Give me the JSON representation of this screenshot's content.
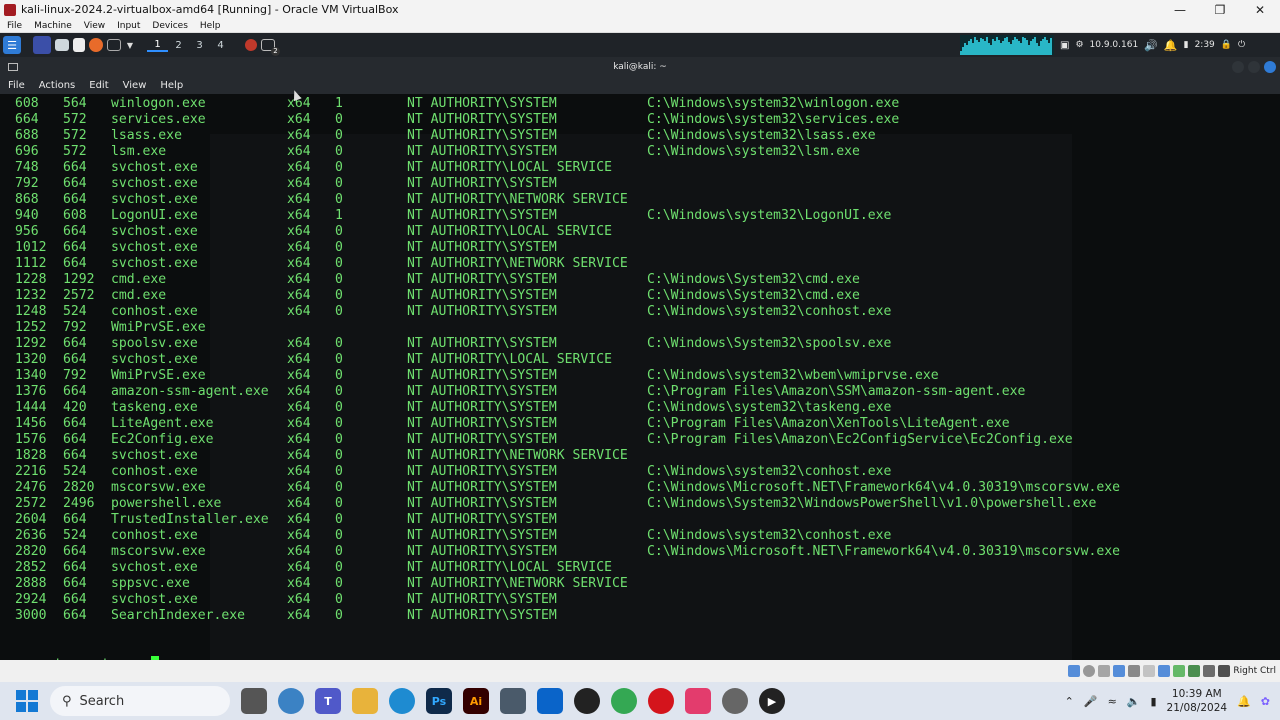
{
  "vbox": {
    "title": "kali-linux-2024.2-virtualbox-amd64 [Running] - Oracle VM VirtualBox",
    "menu": [
      "File",
      "Machine",
      "View",
      "Input",
      "Devices",
      "Help"
    ],
    "status_hint": "Right Ctrl"
  },
  "kali_panel": {
    "workspaces": [
      "1",
      "2",
      "3",
      "4"
    ],
    "active_workspace": "1",
    "terminal_badge": "2",
    "ip_address": "10.9.0.161",
    "time": "2:39"
  },
  "terminal": {
    "title": "kali@kali: ~",
    "menu": [
      "File",
      "Actions",
      "Edit",
      "View",
      "Help"
    ],
    "text_color": "#6fe06f",
    "processes": [
      {
        "pid": "608",
        "ppid": "564",
        "name": "winlogon.exe",
        "arch": "x64",
        "session": "1",
        "user": "NT AUTHORITY\\SYSTEM",
        "path": "C:\\Windows\\system32\\winlogon.exe"
      },
      {
        "pid": "664",
        "ppid": "572",
        "name": "services.exe",
        "arch": "x64",
        "session": "0",
        "user": "NT AUTHORITY\\SYSTEM",
        "path": "C:\\Windows\\system32\\services.exe"
      },
      {
        "pid": "688",
        "ppid": "572",
        "name": "lsass.exe",
        "arch": "x64",
        "session": "0",
        "user": "NT AUTHORITY\\SYSTEM",
        "path": "C:\\Windows\\system32\\lsass.exe"
      },
      {
        "pid": "696",
        "ppid": "572",
        "name": "lsm.exe",
        "arch": "x64",
        "session": "0",
        "user": "NT AUTHORITY\\SYSTEM",
        "path": "C:\\Windows\\system32\\lsm.exe"
      },
      {
        "pid": "748",
        "ppid": "664",
        "name": "svchost.exe",
        "arch": "x64",
        "session": "0",
        "user": "NT AUTHORITY\\LOCAL SERVICE",
        "path": ""
      },
      {
        "pid": "792",
        "ppid": "664",
        "name": "svchost.exe",
        "arch": "x64",
        "session": "0",
        "user": "NT AUTHORITY\\SYSTEM",
        "path": ""
      },
      {
        "pid": "868",
        "ppid": "664",
        "name": "svchost.exe",
        "arch": "x64",
        "session": "0",
        "user": "NT AUTHORITY\\NETWORK SERVICE",
        "path": ""
      },
      {
        "pid": "940",
        "ppid": "608",
        "name": "LogonUI.exe",
        "arch": "x64",
        "session": "1",
        "user": "NT AUTHORITY\\SYSTEM",
        "path": "C:\\Windows\\system32\\LogonUI.exe"
      },
      {
        "pid": "956",
        "ppid": "664",
        "name": "svchost.exe",
        "arch": "x64",
        "session": "0",
        "user": "NT AUTHORITY\\LOCAL SERVICE",
        "path": ""
      },
      {
        "pid": "1012",
        "ppid": "664",
        "name": "svchost.exe",
        "arch": "x64",
        "session": "0",
        "user": "NT AUTHORITY\\SYSTEM",
        "path": ""
      },
      {
        "pid": "1112",
        "ppid": "664",
        "name": "svchost.exe",
        "arch": "x64",
        "session": "0",
        "user": "NT AUTHORITY\\NETWORK SERVICE",
        "path": ""
      },
      {
        "pid": "1228",
        "ppid": "1292",
        "name": "cmd.exe",
        "arch": "x64",
        "session": "0",
        "user": "NT AUTHORITY\\SYSTEM",
        "path": "C:\\Windows\\System32\\cmd.exe"
      },
      {
        "pid": "1232",
        "ppid": "2572",
        "name": "cmd.exe",
        "arch": "x64",
        "session": "0",
        "user": "NT AUTHORITY\\SYSTEM",
        "path": "C:\\Windows\\System32\\cmd.exe"
      },
      {
        "pid": "1248",
        "ppid": "524",
        "name": "conhost.exe",
        "arch": "x64",
        "session": "0",
        "user": "NT AUTHORITY\\SYSTEM",
        "path": "C:\\Windows\\system32\\conhost.exe"
      },
      {
        "pid": "1252",
        "ppid": "792",
        "name": "WmiPrvSE.exe",
        "arch": "",
        "session": "",
        "user": "",
        "path": ""
      },
      {
        "pid": "1292",
        "ppid": "664",
        "name": "spoolsv.exe",
        "arch": "x64",
        "session": "0",
        "user": "NT AUTHORITY\\SYSTEM",
        "path": "C:\\Windows\\System32\\spoolsv.exe"
      },
      {
        "pid": "1320",
        "ppid": "664",
        "name": "svchost.exe",
        "arch": "x64",
        "session": "0",
        "user": "NT AUTHORITY\\LOCAL SERVICE",
        "path": ""
      },
      {
        "pid": "1340",
        "ppid": "792",
        "name": "WmiPrvSE.exe",
        "arch": "x64",
        "session": "0",
        "user": "NT AUTHORITY\\SYSTEM",
        "path": "C:\\Windows\\system32\\wbem\\wmiprvse.exe"
      },
      {
        "pid": "1376",
        "ppid": "664",
        "name": "amazon-ssm-agent.exe",
        "arch": "x64",
        "session": "0",
        "user": "NT AUTHORITY\\SYSTEM",
        "path": "C:\\Program Files\\Amazon\\SSM\\amazon-ssm-agent.exe"
      },
      {
        "pid": "1444",
        "ppid": "420",
        "name": "taskeng.exe",
        "arch": "x64",
        "session": "0",
        "user": "NT AUTHORITY\\SYSTEM",
        "path": "C:\\Windows\\system32\\taskeng.exe"
      },
      {
        "pid": "1456",
        "ppid": "664",
        "name": "LiteAgent.exe",
        "arch": "x64",
        "session": "0",
        "user": "NT AUTHORITY\\SYSTEM",
        "path": "C:\\Program Files\\Amazon\\XenTools\\LiteAgent.exe"
      },
      {
        "pid": "1576",
        "ppid": "664",
        "name": "Ec2Config.exe",
        "arch": "x64",
        "session": "0",
        "user": "NT AUTHORITY\\SYSTEM",
        "path": "C:\\Program Files\\Amazon\\Ec2ConfigService\\Ec2Config.exe"
      },
      {
        "pid": "1828",
        "ppid": "664",
        "name": "svchost.exe",
        "arch": "x64",
        "session": "0",
        "user": "NT AUTHORITY\\NETWORK SERVICE",
        "path": ""
      },
      {
        "pid": "2216",
        "ppid": "524",
        "name": "conhost.exe",
        "arch": "x64",
        "session": "0",
        "user": "NT AUTHORITY\\SYSTEM",
        "path": "C:\\Windows\\system32\\conhost.exe"
      },
      {
        "pid": "2476",
        "ppid": "2820",
        "name": "mscorsvw.exe",
        "arch": "x64",
        "session": "0",
        "user": "NT AUTHORITY\\SYSTEM",
        "path": "C:\\Windows\\Microsoft.NET\\Framework64\\v4.0.30319\\mscorsvw.exe"
      },
      {
        "pid": "2572",
        "ppid": "2496",
        "name": "powershell.exe",
        "arch": "x64",
        "session": "0",
        "user": "NT AUTHORITY\\SYSTEM",
        "path": "C:\\Windows\\System32\\WindowsPowerShell\\v1.0\\powershell.exe"
      },
      {
        "pid": "2604",
        "ppid": "664",
        "name": "TrustedInstaller.exe",
        "arch": "x64",
        "session": "0",
        "user": "NT AUTHORITY\\SYSTEM",
        "path": ""
      },
      {
        "pid": "2636",
        "ppid": "524",
        "name": "conhost.exe",
        "arch": "x64",
        "session": "0",
        "user": "NT AUTHORITY\\SYSTEM",
        "path": "C:\\Windows\\system32\\conhost.exe"
      },
      {
        "pid": "2820",
        "ppid": "664",
        "name": "mscorsvw.exe",
        "arch": "x64",
        "session": "0",
        "user": "NT AUTHORITY\\SYSTEM",
        "path": "C:\\Windows\\Microsoft.NET\\Framework64\\v4.0.30319\\mscorsvw.exe"
      },
      {
        "pid": "2852",
        "ppid": "664",
        "name": "svchost.exe",
        "arch": "x64",
        "session": "0",
        "user": "NT AUTHORITY\\LOCAL SERVICE",
        "path": ""
      },
      {
        "pid": "2888",
        "ppid": "664",
        "name": "sppsvc.exe",
        "arch": "x64",
        "session": "0",
        "user": "NT AUTHORITY\\NETWORK SERVICE",
        "path": ""
      },
      {
        "pid": "2924",
        "ppid": "664",
        "name": "svchost.exe",
        "arch": "x64",
        "session": "0",
        "user": "NT AUTHORITY\\SYSTEM",
        "path": ""
      },
      {
        "pid": "3000",
        "ppid": "664",
        "name": "SearchIndexer.exe",
        "arch": "x64",
        "session": "0",
        "user": "NT AUTHORITY\\SYSTEM",
        "path": ""
      }
    ],
    "prompt": "meterpreter",
    "prompt_symbol": " > "
  },
  "taskbar": {
    "search_label": "Search",
    "apps": [
      {
        "icon": "task-view-icon",
        "color": "#555555"
      },
      {
        "icon": "onedrive-icon",
        "color": "#3b82c4"
      },
      {
        "icon": "teams-icon",
        "color": "#5059c9"
      },
      {
        "icon": "file-explorer-icon",
        "color": "#e8b33b"
      },
      {
        "icon": "edge-icon",
        "color": "#1e8bd1"
      },
      {
        "icon": "photoshop-icon",
        "color": "#0f2a4a"
      },
      {
        "icon": "illustrator-icon",
        "color": "#330000"
      },
      {
        "icon": "3d-viewer-icon",
        "color": "#4a5a6a"
      },
      {
        "icon": "outlook-icon",
        "color": "#0a64c9"
      },
      {
        "icon": "pen-tool-icon",
        "color": "#222222"
      },
      {
        "icon": "chrome-icon",
        "color": "#34a853"
      },
      {
        "icon": "opera-icon",
        "color": "#d4141c"
      },
      {
        "icon": "virtualbox-icon",
        "color": "#e33c6d"
      },
      {
        "icon": "settings-icon",
        "color": "#666666"
      },
      {
        "icon": "media-player-icon",
        "color": "#222222"
      }
    ],
    "app_labels": {
      "ps": "Ps",
      "ai": "Ai"
    },
    "clock_time": "10:39 AM",
    "clock_date": "21/08/2024"
  }
}
